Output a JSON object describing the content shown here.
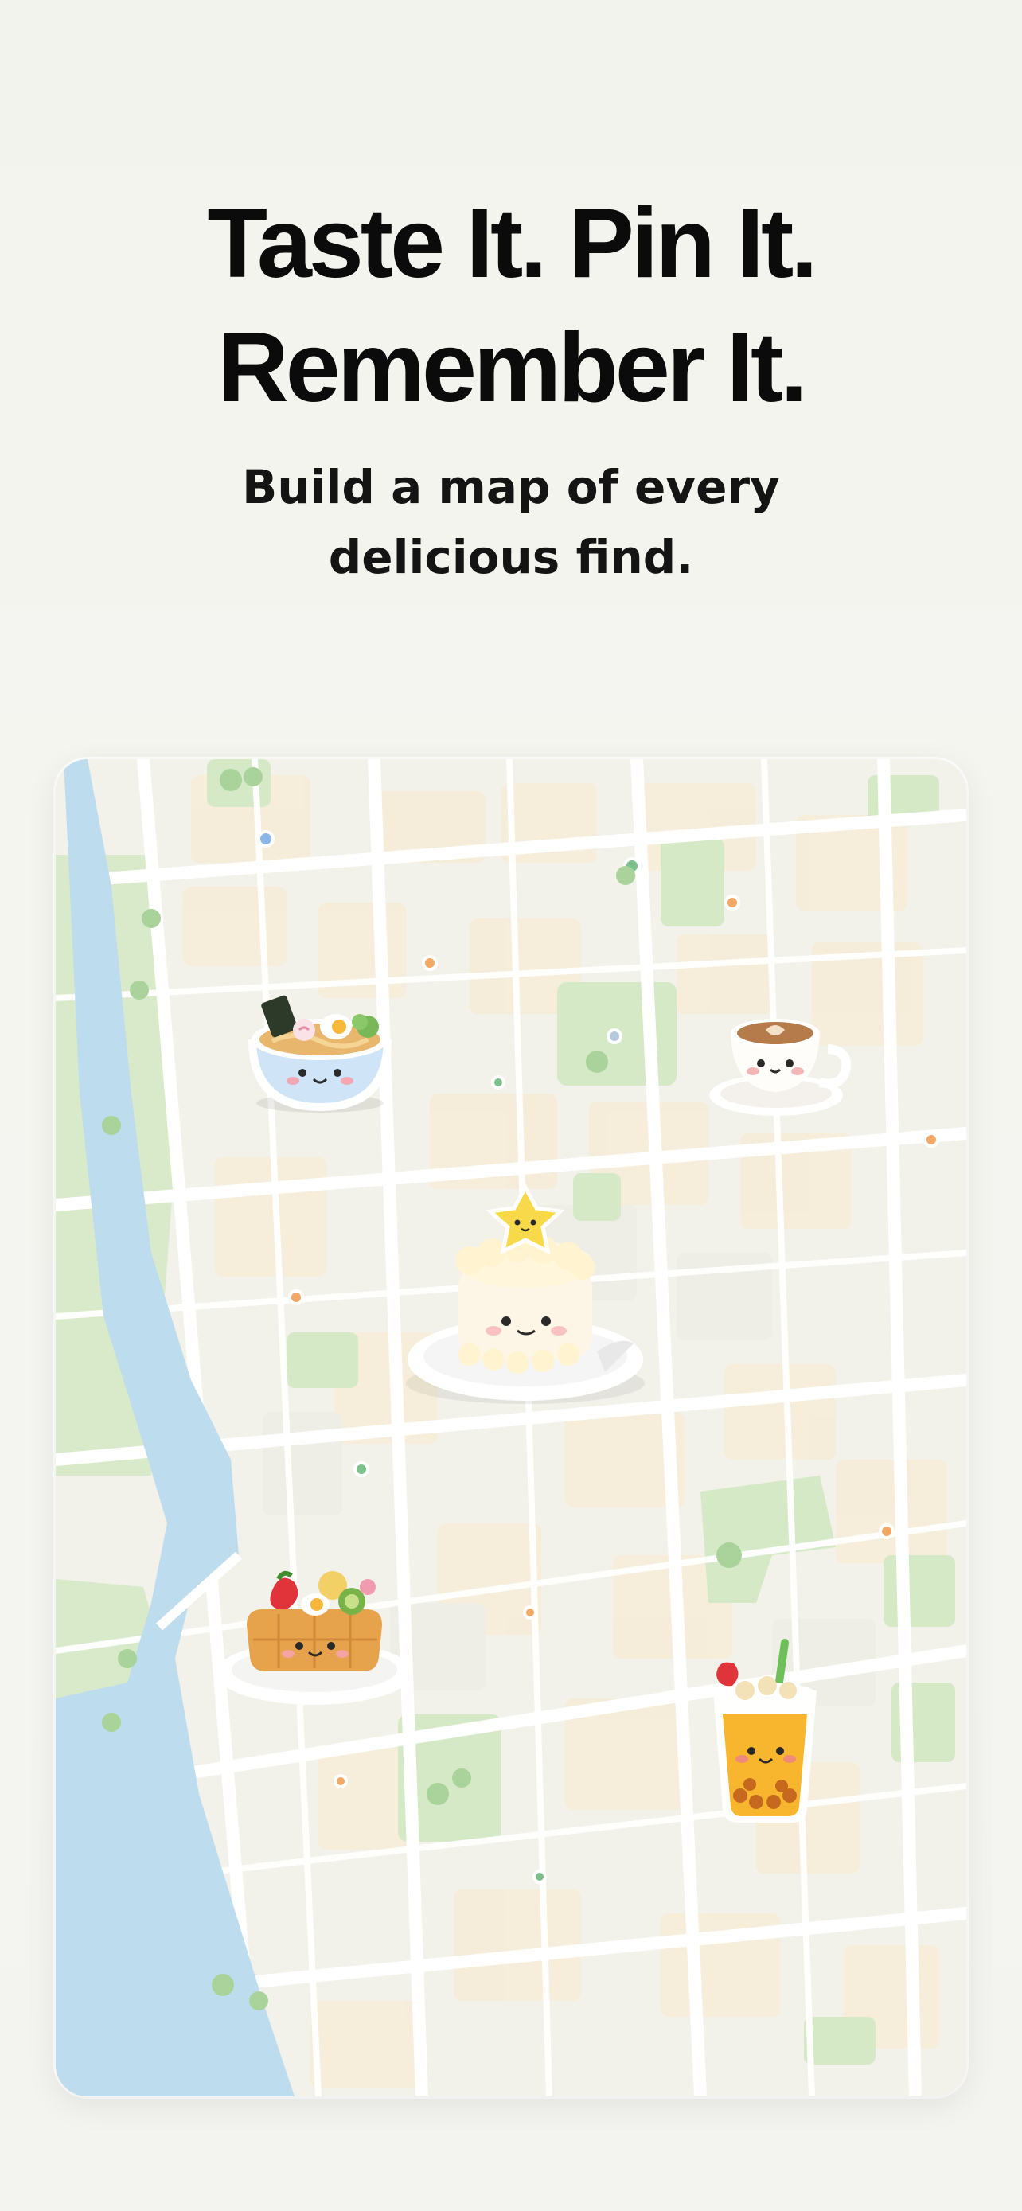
{
  "headline": {
    "line1": "Taste It. Pin It.",
    "line2": "Remember It."
  },
  "subtitle": {
    "line1": "Build a map of every",
    "line2": "delicious find."
  },
  "map": {
    "water_color": "#bcdcef",
    "park_color": "#d4e9c4",
    "block_color": "#f5ecd6",
    "road_color": "#ffffff",
    "food_pins": [
      {
        "name": "ramen-bowl",
        "icon": "ramen-icon"
      },
      {
        "name": "latte-cup",
        "icon": "coffee-icon"
      },
      {
        "name": "star-cake",
        "icon": "cake-icon"
      },
      {
        "name": "fruit-waffle",
        "icon": "waffle-icon"
      },
      {
        "name": "bubble-tea",
        "icon": "bubble-tea-icon"
      }
    ]
  }
}
